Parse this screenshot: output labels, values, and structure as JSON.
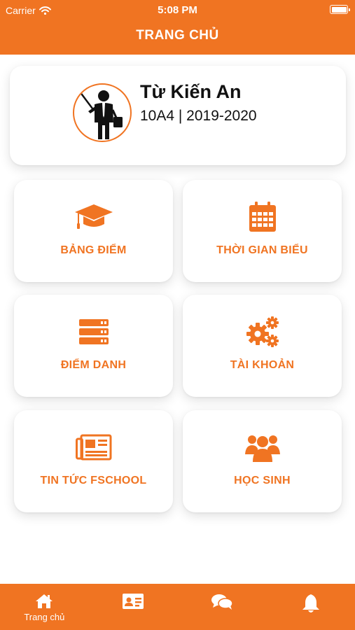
{
  "status_bar": {
    "carrier": "Carrier",
    "time": "5:08 PM"
  },
  "header": {
    "title": "TRANG CHỦ"
  },
  "profile": {
    "name": "Từ Kiến An",
    "class_info": "10A4 | 2019-2020"
  },
  "menu": [
    {
      "label": "BẢNG ĐIỂM",
      "icon": "graduation-cap-icon"
    },
    {
      "label": "THỜI GIAN BIỂU",
      "icon": "calendar-icon"
    },
    {
      "label": "ĐIỂM DANH",
      "icon": "server-list-icon"
    },
    {
      "label": "TÀI KHOẢN",
      "icon": "gears-icon"
    },
    {
      "label": "TIN TỨC FSCHOOL",
      "icon": "newspaper-icon"
    },
    {
      "label": "HỌC SINH",
      "icon": "users-icon"
    }
  ],
  "tabbar": [
    {
      "label": "Trang chủ",
      "icon": "home-icon"
    },
    {
      "label": "",
      "icon": "id-card-icon"
    },
    {
      "label": "",
      "icon": "chat-bubbles-icon"
    },
    {
      "label": "",
      "icon": "bell-icon"
    }
  ],
  "colors": {
    "accent": "#f07422",
    "background": "#ffffff",
    "text": "#111111"
  }
}
